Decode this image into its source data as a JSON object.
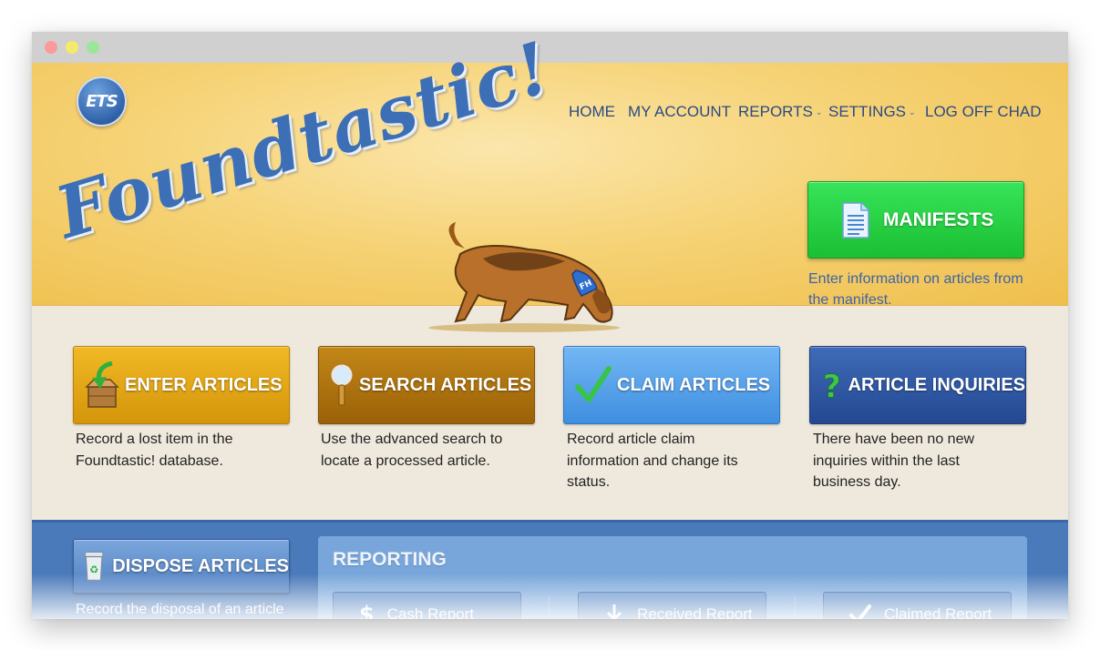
{
  "nav": {
    "items": [
      {
        "label": "HOME"
      },
      {
        "label": "MY ACCOUNT"
      },
      {
        "label": "REPORTS",
        "dropdown": true
      },
      {
        "label": "SETTINGS",
        "dropdown": true
      },
      {
        "label": "LOG OFF CHAD"
      }
    ]
  },
  "logo": {
    "text": "ETS"
  },
  "brand": {
    "title": "Foundtastic!",
    "dog_collar": "FH"
  },
  "manifest": {
    "label": "MANIFESTS",
    "icon": "document-icon",
    "description": "Enter information on articles from the manifest."
  },
  "tiles": [
    {
      "label": "ENTER ARTICLES",
      "icon": "box-arrow-icon",
      "description": "Record a lost item in the Foundtastic! database."
    },
    {
      "label": "SEARCH ARTICLES",
      "icon": "magnifier-icon",
      "description": "Use the advanced search to locate a processed article."
    },
    {
      "label": "CLAIM ARTICLES",
      "icon": "checkmark-icon",
      "description": "Record article claim information and change its status."
    },
    {
      "label": "ARTICLE INQUIRIES",
      "icon": "question-icon",
      "description": "There have been no new inquiries within the last business day."
    }
  ],
  "dispose": {
    "label": "DISPOSE ARTICLES",
    "icon": "recycle-bin-icon",
    "description": "Record the disposal of an article and change its status."
  },
  "reporting": {
    "title": "REPORTING",
    "buttons": [
      {
        "label": "Cash Report",
        "icon": "dollar-icon"
      },
      {
        "label": "Received Report",
        "icon": "download-icon"
      },
      {
        "label": "Claimed Report",
        "icon": "checkmark-icon"
      }
    ]
  },
  "colors": {
    "header_bg": "#f6d377",
    "nav_text": "#2a4a86",
    "manifest_green": "#1bbf32",
    "enter_orange": "#d4950a",
    "search_brown": "#9a6108",
    "claim_blue": "#3f8ee0",
    "inquire_navy": "#244891",
    "bottom_blue": "#4a7ab9"
  }
}
